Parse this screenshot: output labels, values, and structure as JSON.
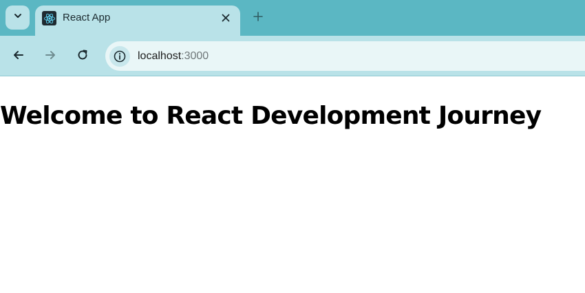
{
  "tab": {
    "title": "React App",
    "favicon": "react-logo-icon"
  },
  "toolbar": {
    "url_host": "localhost",
    "url_port": ":3000"
  },
  "page": {
    "heading": "Welcome to React Development Journey"
  },
  "colors": {
    "tab_strip": "#5bb7c3",
    "active_tab": "#b9e2e8",
    "omnibox": "#e9f6f7",
    "react_logo": "#61dafb"
  },
  "icons": [
    "chevron-down-icon",
    "react-logo-icon",
    "close-icon",
    "plus-icon",
    "back-arrow-icon",
    "forward-arrow-icon",
    "reload-icon",
    "info-icon"
  ]
}
